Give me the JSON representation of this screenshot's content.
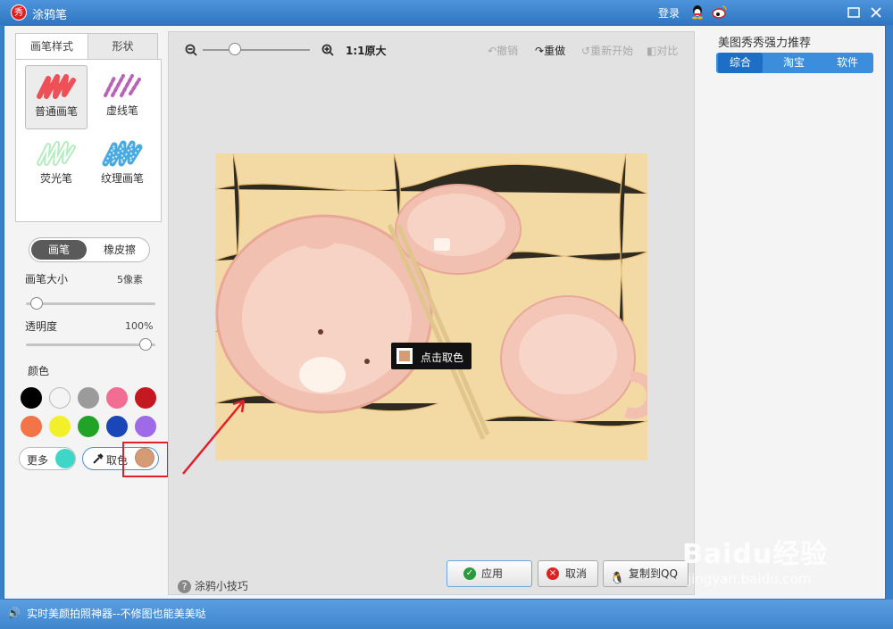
{
  "window": {
    "title": "涂鸦笔",
    "login": "登录"
  },
  "left": {
    "tabs": [
      "画笔样式",
      "形状"
    ],
    "brushes": [
      "普通画笔",
      "虚线笔",
      "荧光笔",
      "纹理画笔"
    ],
    "mode": [
      "画笔",
      "橡皮擦"
    ],
    "size_label": "画笔大小",
    "size_value": "5像素",
    "opacity_label": "透明度",
    "opacity_value": "100%",
    "color_label": "颜色",
    "more_label": "更多",
    "pick_label": "取色",
    "colors": [
      "#000000",
      "#f4f4f4",
      "#9b9b9b",
      "#f26d92",
      "#c41920",
      "#f37446",
      "#f3f02b",
      "#20a326",
      "#1b46b8",
      "#9f6ae8"
    ],
    "more_color": "#3fd6c8",
    "picked_color": "#d59b74"
  },
  "toolbar": {
    "zoom_label": "1:1原大",
    "undo": "撤销",
    "redo": "重做",
    "restart": "重新开始",
    "compare": "对比"
  },
  "canvas": {
    "tooltip": "点击取色",
    "tips": "涂鸦小技巧"
  },
  "actions": {
    "apply": "应用",
    "cancel": "取消",
    "copy_qq": "复制到QQ"
  },
  "right": {
    "title": "美图秀秀强力推荐",
    "tabs": [
      "综合",
      "淘宝",
      "软件"
    ]
  },
  "status": {
    "text": "实时美颜拍照神器--不修图也能美美哒"
  },
  "watermark": {
    "brand": "Baidu经验",
    "url": "jingyan.baidu.com"
  }
}
